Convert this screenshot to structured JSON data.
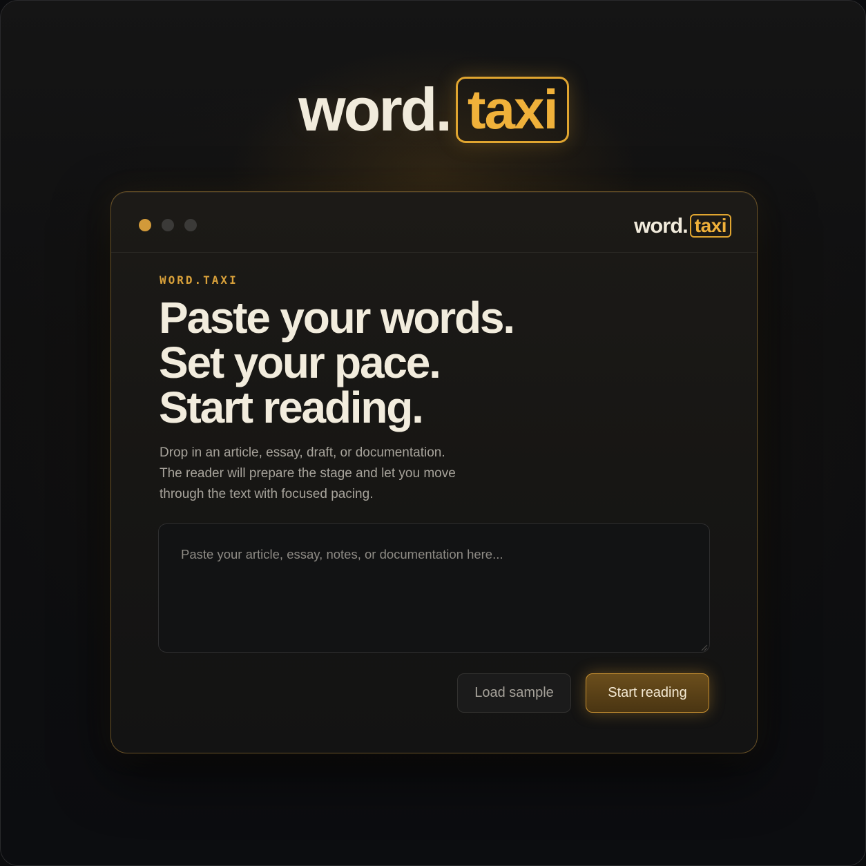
{
  "hero_logo": {
    "word": "word.",
    "highlight": "taxi"
  },
  "window": {
    "titlebar": {
      "logo_word": "word.",
      "logo_highlight": "taxi"
    },
    "eyebrow": "WORD.TAXI",
    "headline": [
      "Paste your words.",
      "Set your pace.",
      "Start reading."
    ],
    "description": [
      "Drop in an article, essay, draft, or documentation.",
      "The reader will prepare the stage and let you move",
      "through the text with focused pacing."
    ],
    "input": {
      "placeholder": "Paste your article, essay, notes, or documentation here...",
      "value": ""
    },
    "buttons": {
      "load_sample": "Load sample",
      "start_reading": "Start reading"
    }
  },
  "colors": {
    "accent": "#e0a530",
    "text_primary": "#f2ecdd",
    "text_muted": "#a7a39b",
    "background": "#0f0f10"
  }
}
